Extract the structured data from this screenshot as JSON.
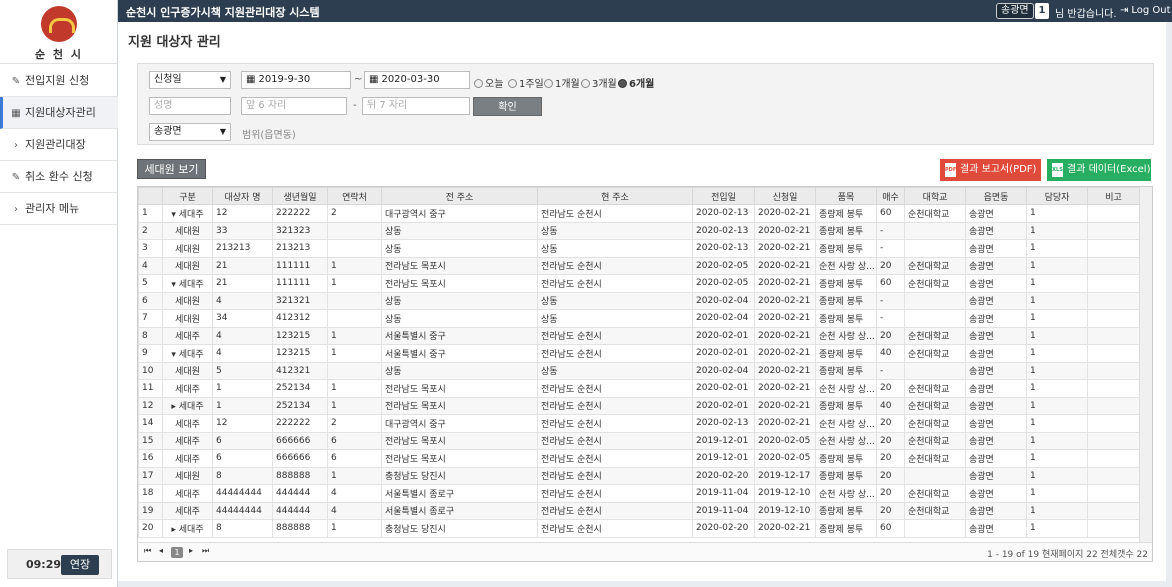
{
  "header": {
    "title": "순천시 인구증가시책 지원관리대장 시스템",
    "user": "송광면",
    "count": "1",
    "greeting": "님 반갑습니다.",
    "logout": "Log Out"
  },
  "sidebar": {
    "logo_text": "순 천 시",
    "items": [
      {
        "icon": "edit",
        "label": "전입지원 신청"
      },
      {
        "icon": "grid",
        "label": "지원대상자관리"
      },
      {
        "icon": "chevron",
        "label": "지원관리대장"
      },
      {
        "icon": "edit",
        "label": "취소 환수 신청"
      },
      {
        "icon": "chevron",
        "label": "관리자 메뉴"
      }
    ],
    "timer": "09:29",
    "extend": "연장"
  },
  "page": {
    "title": "지원 대상자 관리"
  },
  "filter": {
    "date_type": "신청일",
    "date_from": "2019-9-30",
    "tilde": "~",
    "date_to": "2020-03-30",
    "periods": [
      "오늘",
      "1주일",
      "1개월",
      "3개월",
      "6개월"
    ],
    "selected_period": "6개월",
    "name_placeholder": "성명",
    "id_front_placeholder": "앞 6 자리",
    "dash": "-",
    "id_back_placeholder": "뒤 7 자리",
    "confirm": "확인",
    "region": "송광면",
    "scope_label": "범위(읍면동)"
  },
  "actions": {
    "household": "세대원 보기",
    "pdf": "결과 보고서(PDF)",
    "pdf_icon": "PDF",
    "excel": "결과 데이터(Excel)",
    "excel_icon": "XLS"
  },
  "table": {
    "columns": [
      "",
      "구분",
      "대상자 명",
      "생년월일",
      "연락처",
      "전 주소",
      "현 주소",
      "전입일",
      "신청일",
      "품목",
      "매수",
      "대학교",
      "읍면동",
      "담당자",
      "비고"
    ],
    "rows": [
      [
        "1",
        "▾ 세대주",
        "12",
        "222222",
        "2",
        "대구광역시 중구",
        "전라남도 순천시",
        "2020-02-13",
        "2020-02-21",
        "종량제 봉투",
        "60",
        "순천대학교",
        "송광면",
        "1",
        ""
      ],
      [
        "2",
        "세대원",
        "33",
        "321323",
        "",
        "상동",
        "상동",
        "2020-02-13",
        "2020-02-21",
        "종량제 봉투",
        "-",
        "",
        "송광면",
        "1",
        ""
      ],
      [
        "3",
        "세대원",
        "213213",
        "213213",
        "",
        "상동",
        "상동",
        "2020-02-13",
        "2020-02-21",
        "종량제 봉투",
        "-",
        "",
        "송광면",
        "1",
        ""
      ],
      [
        "4",
        "세대원",
        "21",
        "111111",
        "1",
        "전라남도 목포시",
        "전라남도 순천시",
        "2020-02-05",
        "2020-02-21",
        "순천 사랑 상...",
        "20",
        "순천대학교",
        "송광면",
        "1",
        ""
      ],
      [
        "5",
        "▾ 세대주",
        "21",
        "111111",
        "1",
        "전라남도 목포시",
        "전라남도 순천시",
        "2020-02-05",
        "2020-02-21",
        "종량제 봉투",
        "60",
        "순천대학교",
        "송광면",
        "1",
        ""
      ],
      [
        "6",
        "세대원",
        "4",
        "321321",
        "",
        "상동",
        "상동",
        "2020-02-04",
        "2020-02-21",
        "종량제 봉투",
        "-",
        "",
        "송광면",
        "1",
        ""
      ],
      [
        "7",
        "세대원",
        "34",
        "412312",
        "",
        "상동",
        "상동",
        "2020-02-04",
        "2020-02-21",
        "종량제 봉투",
        "-",
        "",
        "송광면",
        "1",
        ""
      ],
      [
        "8",
        "세대주",
        "4",
        "123215",
        "1",
        "서울특별시 중구",
        "전라남도 순천시",
        "2020-02-01",
        "2020-02-21",
        "순천 사랑 상...",
        "20",
        "순천대학교",
        "송광면",
        "1",
        ""
      ],
      [
        "9",
        "▾ 세대주",
        "4",
        "123215",
        "1",
        "서울특별시 중구",
        "전라남도 순천시",
        "2020-02-01",
        "2020-02-21",
        "종량제 봉투",
        "40",
        "순천대학교",
        "송광면",
        "1",
        ""
      ],
      [
        "10",
        "세대원",
        "5",
        "412321",
        "",
        "상동",
        "상동",
        "2020-02-04",
        "2020-02-21",
        "종량제 봉투",
        "-",
        "",
        "송광면",
        "1",
        ""
      ],
      [
        "11",
        "세대주",
        "1",
        "252134",
        "1",
        "전라남도 목포시",
        "전라남도 순천시",
        "2020-02-01",
        "2020-02-21",
        "순천 사랑 상...",
        "20",
        "순천대학교",
        "송광면",
        "1",
        ""
      ],
      [
        "12",
        "▸ 세대주",
        "1",
        "252134",
        "1",
        "전라남도 목포시",
        "전라남도 순천시",
        "2020-02-01",
        "2020-02-21",
        "종량제 봉투",
        "40",
        "순천대학교",
        "송광면",
        "1",
        ""
      ],
      [
        "14",
        "세대주",
        "12",
        "222222",
        "2",
        "대구광역시 중구",
        "전라남도 순천시",
        "2020-02-13",
        "2020-02-21",
        "순천 사랑 상...",
        "20",
        "순천대학교",
        "송광면",
        "1",
        ""
      ],
      [
        "15",
        "세대주",
        "6",
        "666666",
        "6",
        "전라남도 목포시",
        "전라남도 순천시",
        "2019-12-01",
        "2020-02-05",
        "순천 사랑 상...",
        "20",
        "순천대학교",
        "송광면",
        "1",
        ""
      ],
      [
        "16",
        "세대주",
        "6",
        "666666",
        "6",
        "전라남도 목포시",
        "전라남도 순천시",
        "2019-12-01",
        "2020-02-05",
        "종량제 봉투",
        "20",
        "순천대학교",
        "송광면",
        "1",
        ""
      ],
      [
        "17",
        "세대원",
        "8",
        "888888",
        "1",
        "충청남도 당진시",
        "전라남도 순천시",
        "2020-02-20",
        "2019-12-17",
        "종량제 봉투",
        "20",
        "",
        "송광면",
        "1",
        ""
      ],
      [
        "18",
        "세대주",
        "44444444",
        "444444",
        "4",
        "서울특별시 종로구",
        "전라남도 순천시",
        "2019-11-04",
        "2019-12-10",
        "순천 사랑 상...",
        "20",
        "순천대학교",
        "송광면",
        "1",
        ""
      ],
      [
        "19",
        "세대주",
        "44444444",
        "444444",
        "4",
        "서울특별시 종로구",
        "전라남도 순천시",
        "2019-11-04",
        "2019-12-10",
        "종량제 봉투",
        "20",
        "순천대학교",
        "송광면",
        "1",
        ""
      ],
      [
        "20",
        "▸ 세대주",
        "8",
        "888888",
        "1",
        "충청남도 당진시",
        "전라남도 순천시",
        "2020-02-20",
        "2020-02-21",
        "종량제 봉투",
        "60",
        "",
        "송광면",
        "1",
        ""
      ]
    ]
  },
  "pager": {
    "first": "⏮",
    "prev": "◂",
    "current": "1",
    "next": "▸",
    "last": "⏭",
    "info": "1 - 19 of 19 현재페이지 22 전체갯수 22"
  }
}
